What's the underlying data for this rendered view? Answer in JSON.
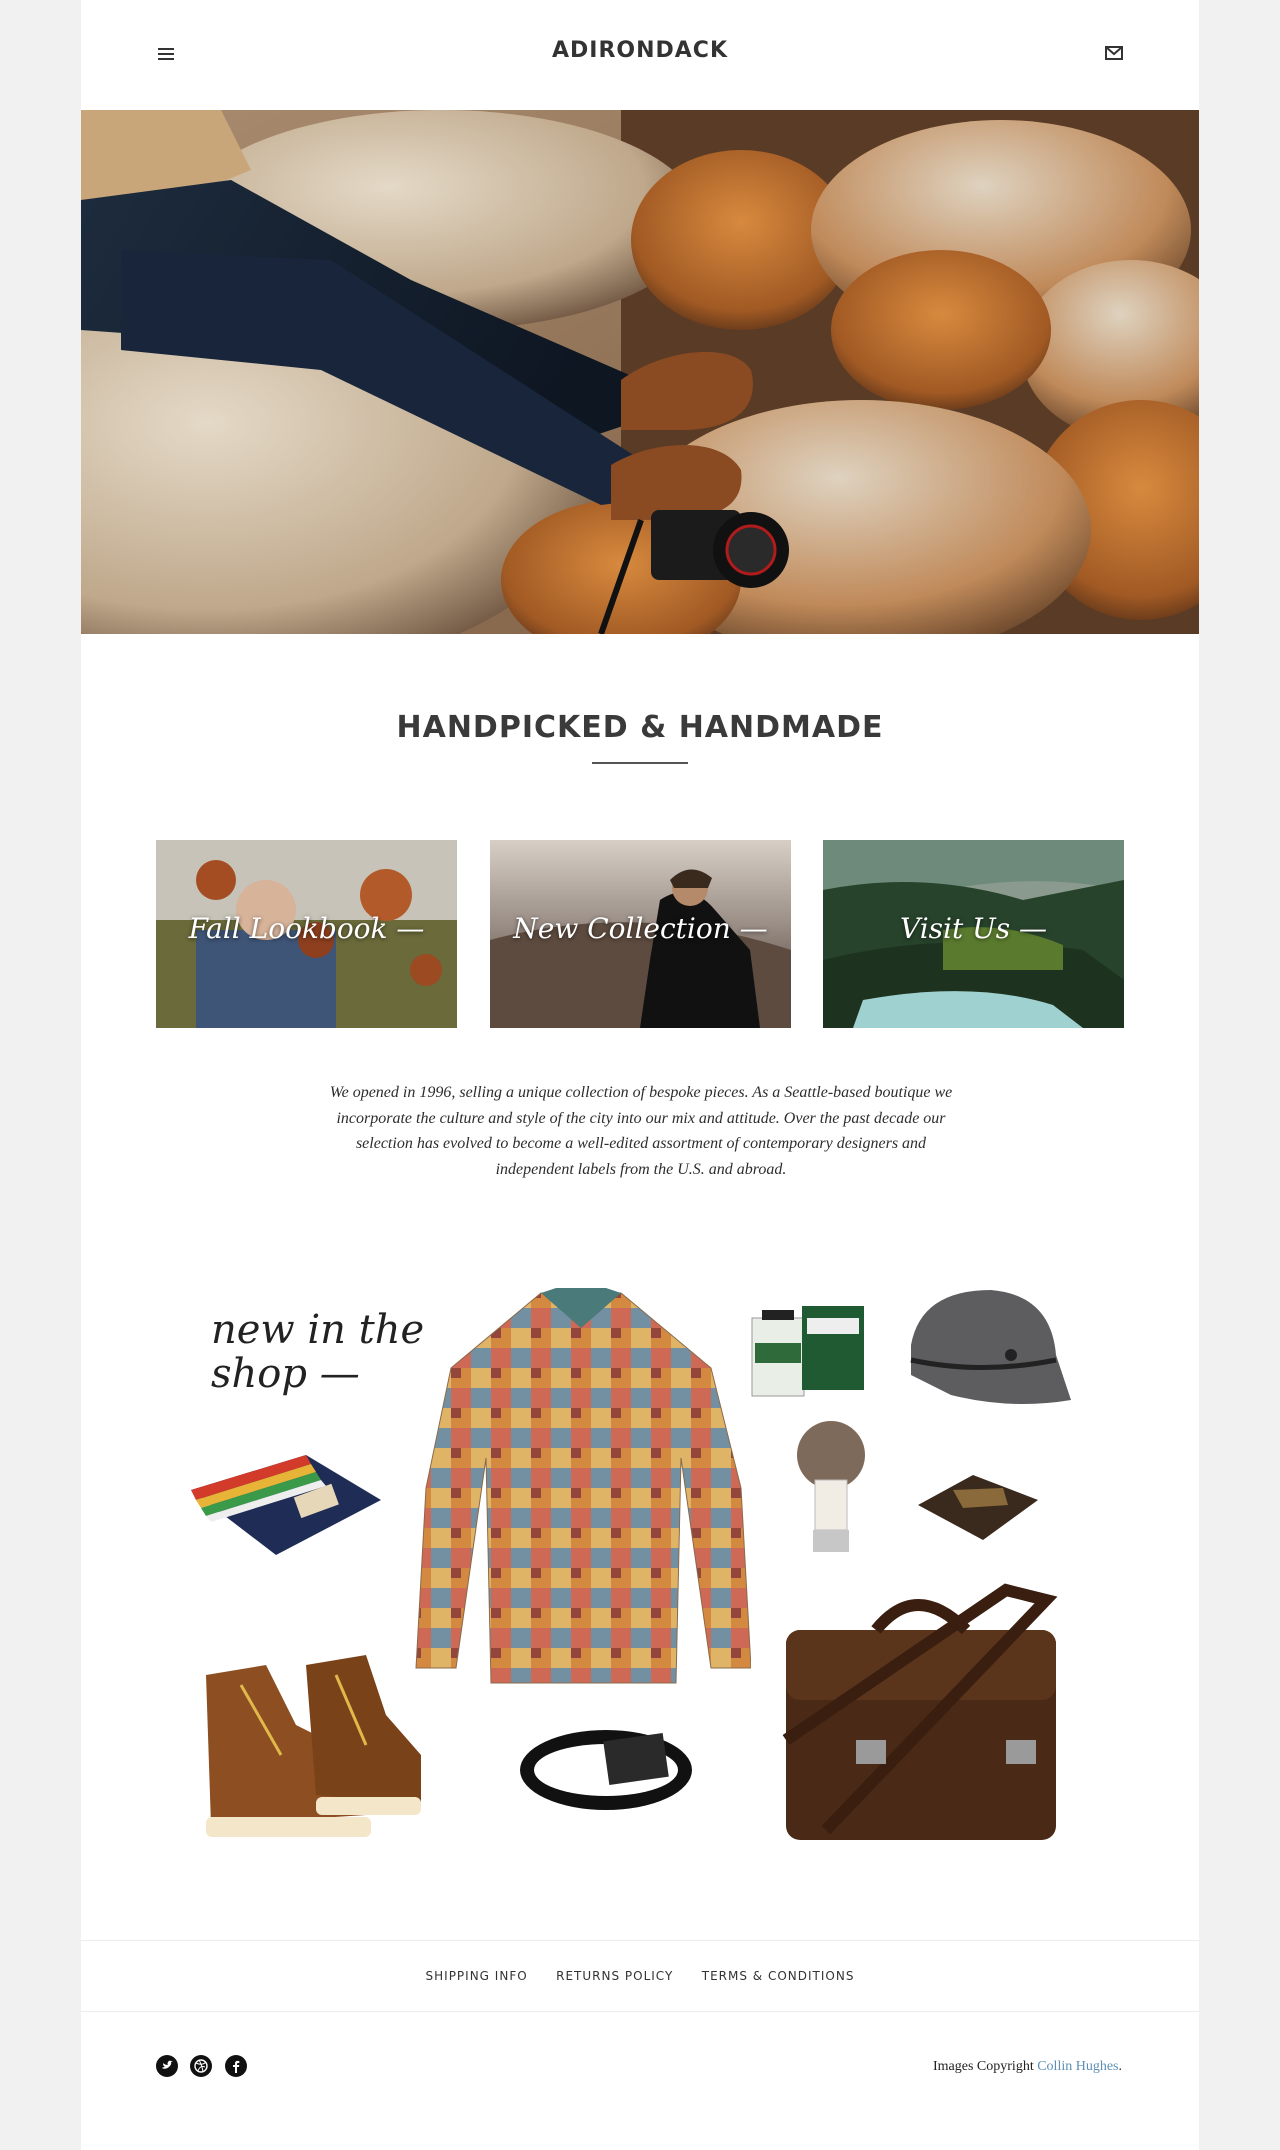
{
  "header": {
    "site_title": "ADIRONDACK",
    "menu_icon": "hamburger-menu-icon",
    "mail_icon": "mail-icon"
  },
  "hero": {
    "image": "person-on-rocks-with-camera"
  },
  "section": {
    "heading": "HANDPICKED & HANDMADE"
  },
  "tiles": [
    {
      "label": "Fall Lookbook —"
    },
    {
      "label": "New Collection —"
    },
    {
      "label": "Visit Us —"
    }
  ],
  "intro": {
    "text": "We opened in 1996, selling a unique collection of bespoke pieces. As a Seattle-based boutique we incorporate the culture and style of the city into our mix and attitude. Over the past decade our selection has evolved to become a well-edited assortment of contemporary designers and independent labels from the U.S. and abroad."
  },
  "shop": {
    "heading_line1": "new in the",
    "heading_line2": "shop —",
    "products": [
      "plaid-shirt",
      "shaving-cream",
      "wool-cap",
      "shaving-brush",
      "wallet",
      "blanket",
      "boots",
      "belt",
      "leather-briefcase"
    ]
  },
  "footer": {
    "links": [
      "SHIPPING INFO",
      "RETURNS POLICY",
      "TERMS & CONDITIONS"
    ],
    "social_icons": [
      "twitter-icon",
      "dribbble-icon",
      "facebook-icon"
    ],
    "copyright_prefix": "Images Copyright",
    "copyright_name": "Collin Hughes",
    "copyright_suffix": "."
  },
  "colors": {
    "background": "#f1f1f1",
    "page": "#ffffff",
    "text": "#333333",
    "link": "#5b8fb4"
  }
}
